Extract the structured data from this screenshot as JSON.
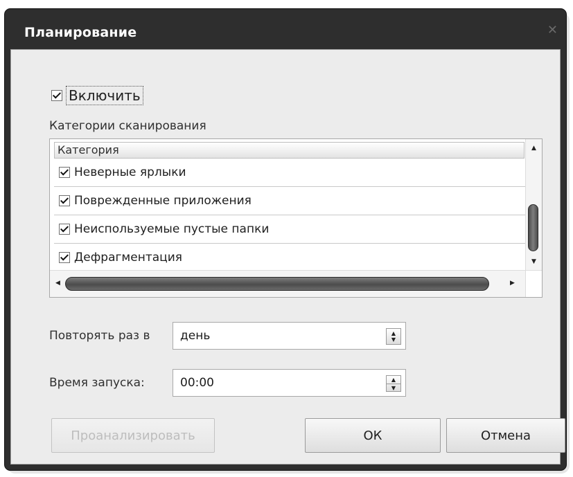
{
  "dialog": {
    "title": "Планирование",
    "close_icon": "close-icon"
  },
  "enable": {
    "label": "Включить",
    "checked": true
  },
  "categories": {
    "section_label": "Категории сканирования",
    "column_header": "Категория",
    "items": [
      {
        "label": "Неверные ярлыки",
        "checked": true
      },
      {
        "label": "Поврежденные приложения",
        "checked": true
      },
      {
        "label": "Неиспользуемые пустые папки",
        "checked": true
      },
      {
        "label": "Дефрагментация",
        "checked": true
      }
    ]
  },
  "repeat": {
    "label": "Повторять раз в",
    "value": "день"
  },
  "start_time": {
    "label": "Время запуска:",
    "value": "00:00"
  },
  "buttons": {
    "disabled_label": "Проанализировать",
    "ok": "ОК",
    "cancel": "Отмена"
  }
}
